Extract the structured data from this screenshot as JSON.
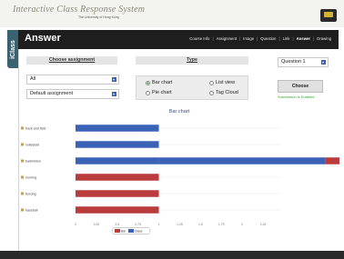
{
  "header": {
    "logo_title": "Interactive Class Response System",
    "logo_subtitle": "The University of Hong Kong"
  },
  "side_tab": {
    "label": "iClass"
  },
  "topbar": {
    "title": "Answer",
    "nav": [
      {
        "label": "Course Info",
        "active": false
      },
      {
        "label": "Assignment",
        "active": false
      },
      {
        "label": "Image",
        "active": false
      },
      {
        "label": "Question",
        "active": false
      },
      {
        "label": "Link",
        "active": false
      },
      {
        "label": "Answer",
        "active": true
      },
      {
        "label": "Drawing",
        "active": false
      }
    ]
  },
  "assignment": {
    "heading": "Choose assignment",
    "filter_value": "All",
    "assignment_value": "Default assignment"
  },
  "type": {
    "heading": "Type",
    "options": [
      {
        "label": "Bar chart",
        "checked": true
      },
      {
        "label": "List view",
        "checked": false
      },
      {
        "label": "Pie chart",
        "checked": false
      },
      {
        "label": "Tag Cloud",
        "checked": false
      }
    ]
  },
  "question": {
    "value": "Question 1",
    "choose_label": "Choose",
    "submission_text": "Submission is Enabled"
  },
  "chart_data": {
    "type": "bar",
    "title": "Bar chart",
    "categories": [
      "track and field",
      "volleyball",
      "badminton",
      "running",
      "fencing",
      "baseball"
    ],
    "series": [
      {
        "values": [
          1,
          1,
          1,
          0,
          0,
          0
        ],
        "color": "#3a63b8"
      },
      {
        "values": [
          0,
          0,
          2,
          0,
          0,
          0
        ],
        "color": "#3a63b8"
      },
      {
        "values": [
          0,
          0,
          1,
          1,
          1,
          1
        ],
        "color": "#b93b3b"
      }
    ],
    "x_ticks": [
      "0",
      "0.25",
      "0.5",
      "0.75",
      "1",
      "1.25",
      "1.5",
      "1.75",
      "2",
      "2.25"
    ],
    "xlim": [
      0,
      2.25
    ],
    "legend": [
      "Bar",
      "Class"
    ]
  },
  "colors": {
    "topbar": "#1e1e1e",
    "blue_bar": "#3a63b8",
    "red_bar": "#b93b3b",
    "accent_green": "#33aa33"
  }
}
